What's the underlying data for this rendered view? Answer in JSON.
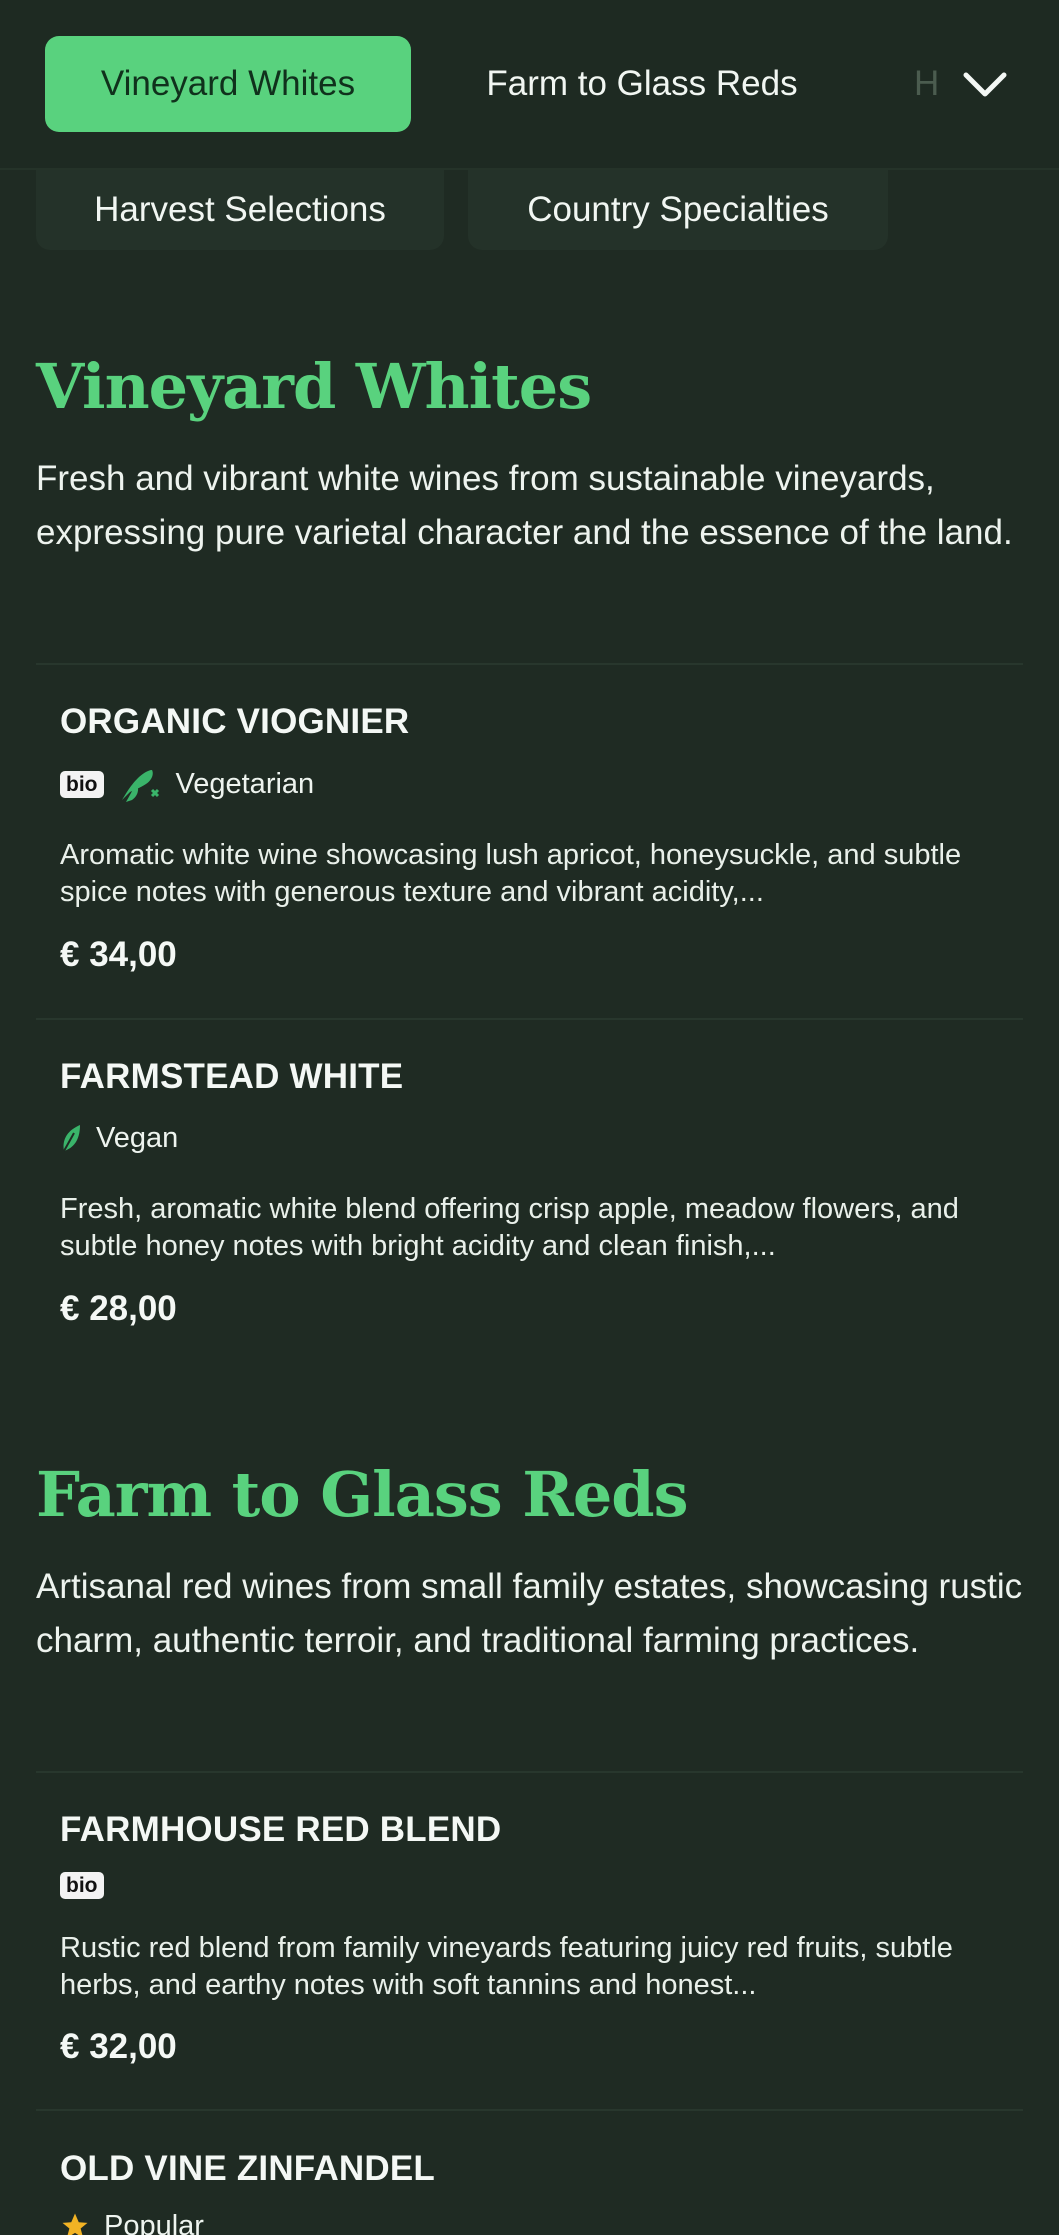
{
  "tabs": {
    "items": [
      {
        "label": "Vineyard Whites"
      },
      {
        "label": "Farm to Glass Reds"
      },
      {
        "label": "H"
      }
    ]
  },
  "chips": [
    {
      "label": "Harvest Selections"
    },
    {
      "label": "Country Specialties"
    }
  ],
  "sections": [
    {
      "title": "Vineyard Whites",
      "description": "Fresh and vibrant white wines from sustainable vineyards, expressing pure varietal character and the essence of the land.",
      "items": [
        {
          "name": "ORGANIC VIOGNIER",
          "badge": "bio",
          "tag": "Vegetarian",
          "description": "Aromatic white wine showcasing lush apricot, honeysuckle, and subtle spice notes with generous texture and vibrant acidity,...",
          "price": "€ 34,00"
        },
        {
          "name": "FARMSTEAD WHITE",
          "tag": "Vegan",
          "description": "Fresh, aromatic white blend offering crisp apple, meadow flowers, and subtle honey notes with bright acidity and clean finish,...",
          "price": "€ 28,00"
        }
      ]
    },
    {
      "title": "Farm to Glass Reds",
      "description": "Artisanal red wines from small family estates, showcasing rustic charm, authentic terroir, and traditional farming practices.",
      "items": [
        {
          "name": "FARMHOUSE RED BLEND",
          "badge": "bio",
          "description": "Rustic red blend from family vineyards featuring juicy red fruits, subtle herbs, and earthy notes with soft tannins and honest...",
          "price": "€ 32,00"
        },
        {
          "name": "OLD VINE ZINFANDEL",
          "tag": "Popular"
        }
      ]
    }
  ],
  "icons": {
    "chevron": "chevron-down-icon",
    "vegetarian": "vegetarian-icon",
    "vegan": "vegan-leaf-icon",
    "popular": "star-icon"
  },
  "colors": {
    "background": "#1f2b23",
    "accent": "#59d27e",
    "active_tab_text": "#10311c",
    "star": "#f2b324"
  }
}
